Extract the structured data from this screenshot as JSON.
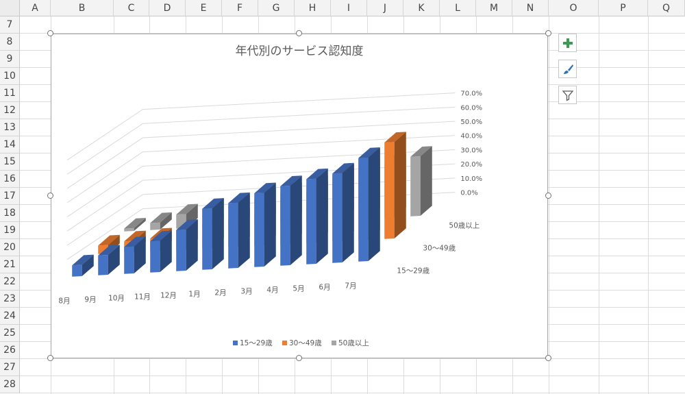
{
  "spreadsheet": {
    "columns": [
      "A",
      "B",
      "C",
      "D",
      "E",
      "F",
      "G",
      "H",
      "I",
      "J",
      "K",
      "L",
      "M",
      "N",
      "O",
      "P",
      "Q"
    ],
    "rows": [
      "7",
      "8",
      "9",
      "10",
      "11",
      "12",
      "13",
      "14",
      "15",
      "16",
      "17",
      "18",
      "19",
      "20",
      "21",
      "22",
      "23",
      "24",
      "25",
      "26",
      "27",
      "28"
    ]
  },
  "chart_data": {
    "type": "bar",
    "subtype": "3d-column",
    "title": "年代別のサービス認知度",
    "categories": [
      "8月",
      "9月",
      "10月",
      "11月",
      "12月",
      "1月",
      "2月",
      "3月",
      "4月",
      "5月",
      "6月",
      "7月"
    ],
    "series": [
      {
        "name": "15〜29歳",
        "color": "#4472c4",
        "values": [
          0.08,
          0.14,
          0.19,
          0.22,
          0.29,
          0.43,
          0.46,
          0.52,
          0.56,
          0.6,
          0.63,
          0.73
        ]
      },
      {
        "name": "30〜49歳",
        "color": "#ed7d31",
        "values": [
          0.06,
          0.08,
          0.09,
          0.14,
          0.17,
          0.2,
          0.23,
          0.32,
          0.36,
          0.47,
          0.57,
          0.68
        ]
      },
      {
        "name": "50歳以上",
        "color": "#a5a5a5",
        "values": [
          0.02,
          0.05,
          0.1,
          0.13,
          0.14,
          0.18,
          0.21,
          0.25,
          0.3,
          0.35,
          0.38,
          0.42
        ]
      }
    ],
    "yticks": [
      "0.0%",
      "10.0%",
      "20.0%",
      "30.0%",
      "40.0%",
      "50.0%",
      "60.0%",
      "70.0%"
    ],
    "ylim": [
      0,
      0.7
    ],
    "legend_position": "bottom",
    "grid": true
  },
  "side_buttons": [
    {
      "icon": "plus-icon",
      "color": "#3c9b53"
    },
    {
      "icon": "brush-icon",
      "color": "#2e75b6"
    },
    {
      "icon": "filter-icon",
      "color": "#595959"
    }
  ]
}
